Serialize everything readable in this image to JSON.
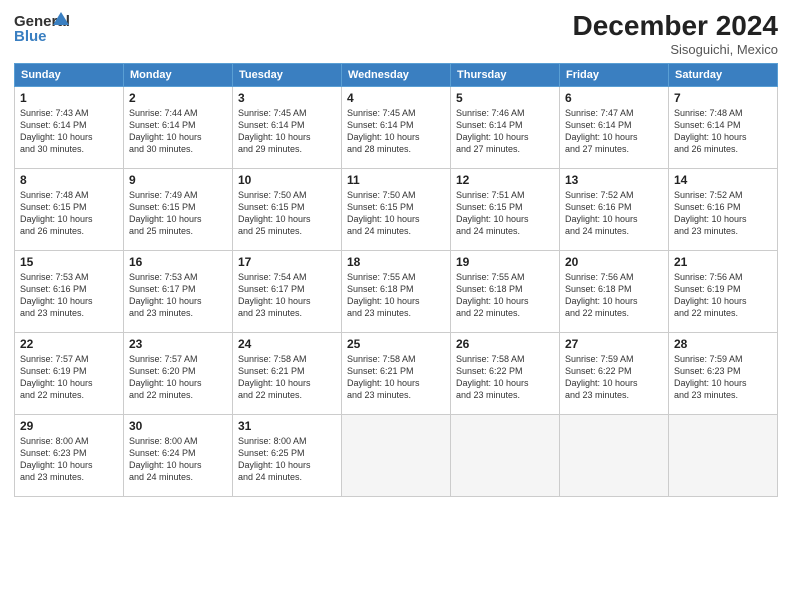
{
  "header": {
    "logo_line1": "General",
    "logo_line2": "Blue",
    "month": "December 2024",
    "location": "Sisoguichi, Mexico"
  },
  "days_of_week": [
    "Sunday",
    "Monday",
    "Tuesday",
    "Wednesday",
    "Thursday",
    "Friday",
    "Saturday"
  ],
  "weeks": [
    [
      {
        "day": "1",
        "info": "Sunrise: 7:43 AM\nSunset: 6:14 PM\nDaylight: 10 hours\nand 30 minutes."
      },
      {
        "day": "2",
        "info": "Sunrise: 7:44 AM\nSunset: 6:14 PM\nDaylight: 10 hours\nand 30 minutes."
      },
      {
        "day": "3",
        "info": "Sunrise: 7:45 AM\nSunset: 6:14 PM\nDaylight: 10 hours\nand 29 minutes."
      },
      {
        "day": "4",
        "info": "Sunrise: 7:45 AM\nSunset: 6:14 PM\nDaylight: 10 hours\nand 28 minutes."
      },
      {
        "day": "5",
        "info": "Sunrise: 7:46 AM\nSunset: 6:14 PM\nDaylight: 10 hours\nand 27 minutes."
      },
      {
        "day": "6",
        "info": "Sunrise: 7:47 AM\nSunset: 6:14 PM\nDaylight: 10 hours\nand 27 minutes."
      },
      {
        "day": "7",
        "info": "Sunrise: 7:48 AM\nSunset: 6:14 PM\nDaylight: 10 hours\nand 26 minutes."
      }
    ],
    [
      {
        "day": "8",
        "info": "Sunrise: 7:48 AM\nSunset: 6:15 PM\nDaylight: 10 hours\nand 26 minutes."
      },
      {
        "day": "9",
        "info": "Sunrise: 7:49 AM\nSunset: 6:15 PM\nDaylight: 10 hours\nand 25 minutes."
      },
      {
        "day": "10",
        "info": "Sunrise: 7:50 AM\nSunset: 6:15 PM\nDaylight: 10 hours\nand 25 minutes."
      },
      {
        "day": "11",
        "info": "Sunrise: 7:50 AM\nSunset: 6:15 PM\nDaylight: 10 hours\nand 24 minutes."
      },
      {
        "day": "12",
        "info": "Sunrise: 7:51 AM\nSunset: 6:15 PM\nDaylight: 10 hours\nand 24 minutes."
      },
      {
        "day": "13",
        "info": "Sunrise: 7:52 AM\nSunset: 6:16 PM\nDaylight: 10 hours\nand 24 minutes."
      },
      {
        "day": "14",
        "info": "Sunrise: 7:52 AM\nSunset: 6:16 PM\nDaylight: 10 hours\nand 23 minutes."
      }
    ],
    [
      {
        "day": "15",
        "info": "Sunrise: 7:53 AM\nSunset: 6:16 PM\nDaylight: 10 hours\nand 23 minutes."
      },
      {
        "day": "16",
        "info": "Sunrise: 7:53 AM\nSunset: 6:17 PM\nDaylight: 10 hours\nand 23 minutes."
      },
      {
        "day": "17",
        "info": "Sunrise: 7:54 AM\nSunset: 6:17 PM\nDaylight: 10 hours\nand 23 minutes."
      },
      {
        "day": "18",
        "info": "Sunrise: 7:55 AM\nSunset: 6:18 PM\nDaylight: 10 hours\nand 23 minutes."
      },
      {
        "day": "19",
        "info": "Sunrise: 7:55 AM\nSunset: 6:18 PM\nDaylight: 10 hours\nand 22 minutes."
      },
      {
        "day": "20",
        "info": "Sunrise: 7:56 AM\nSunset: 6:18 PM\nDaylight: 10 hours\nand 22 minutes."
      },
      {
        "day": "21",
        "info": "Sunrise: 7:56 AM\nSunset: 6:19 PM\nDaylight: 10 hours\nand 22 minutes."
      }
    ],
    [
      {
        "day": "22",
        "info": "Sunrise: 7:57 AM\nSunset: 6:19 PM\nDaylight: 10 hours\nand 22 minutes."
      },
      {
        "day": "23",
        "info": "Sunrise: 7:57 AM\nSunset: 6:20 PM\nDaylight: 10 hours\nand 22 minutes."
      },
      {
        "day": "24",
        "info": "Sunrise: 7:58 AM\nSunset: 6:21 PM\nDaylight: 10 hours\nand 22 minutes."
      },
      {
        "day": "25",
        "info": "Sunrise: 7:58 AM\nSunset: 6:21 PM\nDaylight: 10 hours\nand 23 minutes."
      },
      {
        "day": "26",
        "info": "Sunrise: 7:58 AM\nSunset: 6:22 PM\nDaylight: 10 hours\nand 23 minutes."
      },
      {
        "day": "27",
        "info": "Sunrise: 7:59 AM\nSunset: 6:22 PM\nDaylight: 10 hours\nand 23 minutes."
      },
      {
        "day": "28",
        "info": "Sunrise: 7:59 AM\nSunset: 6:23 PM\nDaylight: 10 hours\nand 23 minutes."
      }
    ],
    [
      {
        "day": "29",
        "info": "Sunrise: 8:00 AM\nSunset: 6:23 PM\nDaylight: 10 hours\nand 23 minutes."
      },
      {
        "day": "30",
        "info": "Sunrise: 8:00 AM\nSunset: 6:24 PM\nDaylight: 10 hours\nand 24 minutes."
      },
      {
        "day": "31",
        "info": "Sunrise: 8:00 AM\nSunset: 6:25 PM\nDaylight: 10 hours\nand 24 minutes."
      },
      {
        "day": "",
        "info": ""
      },
      {
        "day": "",
        "info": ""
      },
      {
        "day": "",
        "info": ""
      },
      {
        "day": "",
        "info": ""
      }
    ]
  ]
}
